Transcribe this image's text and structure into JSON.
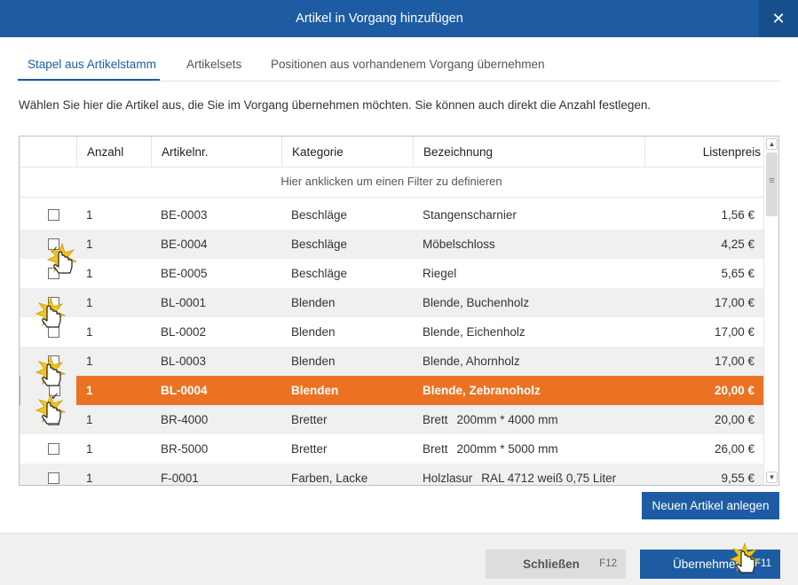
{
  "window": {
    "title": "Artikel in Vorgang hinzufügen",
    "close_glyph": "✕"
  },
  "tabs": [
    {
      "label": "Stapel aus Artikelstamm",
      "active": true
    },
    {
      "label": "Artikelsets",
      "active": false
    },
    {
      "label": "Positionen aus vorhandenem Vorgang übernehmen",
      "active": false
    }
  ],
  "description": "Wählen Sie hier die Artikel aus, die Sie im Vorgang übernehmen möchten. Sie können auch direkt die Anzahl festlegen.",
  "grid": {
    "columns": {
      "qty": "Anzahl",
      "article": "Artikelnr.",
      "category": "Kategorie",
      "name": "Bezeichnung",
      "price": "Listenpreis"
    },
    "filter_hint": "Hier anklicken um einen Filter zu definieren",
    "rows": [
      {
        "checked": false,
        "qty": "1",
        "article": "BE-0003",
        "category": "Beschläge",
        "name": "Stangenscharnier",
        "ext": "",
        "price": "1,56 €"
      },
      {
        "checked": true,
        "qty": "1",
        "article": "BE-0004",
        "category": "Beschläge",
        "name": "Möbelschloss",
        "ext": "",
        "price": "4,25 €"
      },
      {
        "checked": false,
        "qty": "1",
        "article": "BE-0005",
        "category": "Beschläge",
        "name": "Riegel",
        "ext": "",
        "price": "5,65 €"
      },
      {
        "checked": true,
        "qty": "1",
        "article": "BL-0001",
        "category": "Blenden",
        "name": "Blende, Buchenholz",
        "ext": "",
        "price": "17,00 €"
      },
      {
        "checked": false,
        "qty": "1",
        "article": "BL-0002",
        "category": "Blenden",
        "name": "Blende, Eichenholz",
        "ext": "",
        "price": "17,00 €"
      },
      {
        "checked": true,
        "qty": "1",
        "article": "BL-0003",
        "category": "Blenden",
        "name": "Blende, Ahornholz",
        "ext": "",
        "price": "17,00 €"
      },
      {
        "checked": true,
        "qty": "1",
        "article": "BL-0004",
        "category": "Blenden",
        "name": "Blende, Zebranoholz",
        "ext": "",
        "price": "20,00 €",
        "selected": true
      },
      {
        "checked": false,
        "qty": "1",
        "article": "BR-4000",
        "category": "Bretter",
        "name": "Brett",
        "ext": "200mm * 4000 mm",
        "price": "20,00 €"
      },
      {
        "checked": false,
        "qty": "1",
        "article": "BR-5000",
        "category": "Bretter",
        "name": "Brett",
        "ext": "200mm * 5000 mm",
        "price": "26,00 €"
      },
      {
        "checked": false,
        "qty": "1",
        "article": "F-0001",
        "category": "Farben, Lacke",
        "name": "Holzlasur",
        "ext": "RAL 4712 weiß 0,75 Liter",
        "price": "9,55 €"
      }
    ]
  },
  "buttons": {
    "new_article": "Neuen Artikel anlegen",
    "close": "Schließen",
    "close_key": "F12",
    "accept": "Übernehmen",
    "accept_key": "F11"
  },
  "colors": {
    "primary": "#1d5ca3",
    "selection": "#ec7223",
    "row_alt": "#f0f0f0"
  },
  "scrollbar": {
    "up_glyph": "▲",
    "down_glyph": "▼"
  }
}
